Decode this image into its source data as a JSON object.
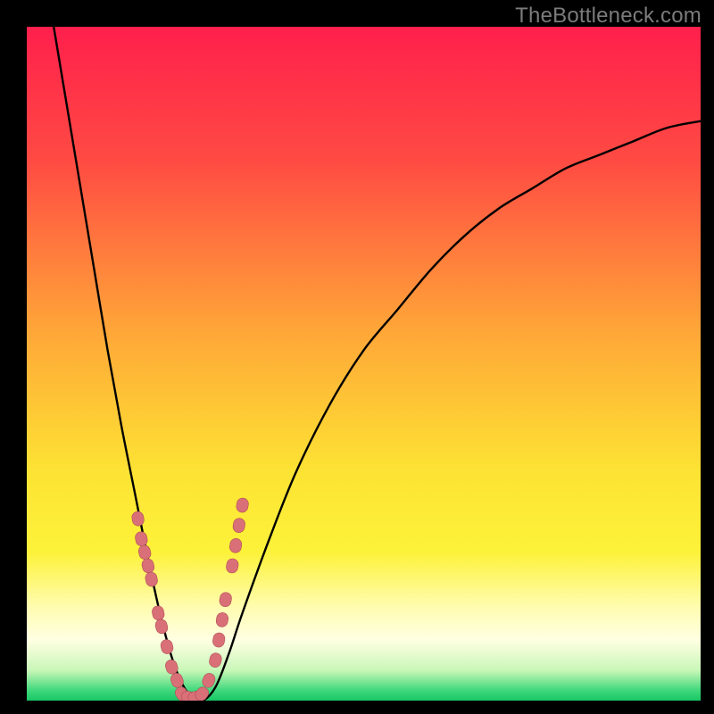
{
  "watermark": "TheBottleneck.com",
  "colors": {
    "frame": "#000000",
    "gradient_stops": [
      {
        "offset": 0.0,
        "color": "#ff1f4c"
      },
      {
        "offset": 0.2,
        "color": "#ff4b43"
      },
      {
        "offset": 0.45,
        "color": "#ffa638"
      },
      {
        "offset": 0.66,
        "color": "#fde333"
      },
      {
        "offset": 0.78,
        "color": "#fdf23a"
      },
      {
        "offset": 0.86,
        "color": "#fffcae"
      },
      {
        "offset": 0.91,
        "color": "#ffffe3"
      },
      {
        "offset": 0.955,
        "color": "#c9f7b8"
      },
      {
        "offset": 0.985,
        "color": "#3fd87b"
      },
      {
        "offset": 1.0,
        "color": "#17c765"
      }
    ],
    "curve": "#000000",
    "marker_fill": "#d97078",
    "marker_stroke": "#b24e56"
  },
  "chart_data": {
    "type": "line",
    "title": "",
    "xlabel": "",
    "ylabel": "",
    "xlim": [
      0,
      100
    ],
    "ylim": [
      0,
      100
    ],
    "series": [
      {
        "name": "bottleneck-curve",
        "comment": "V-shaped curve; y estimated as percentage from top (0=top, 100=bottom). Minimum (best/green zone) around x≈22–26.",
        "x": [
          4,
          6,
          8,
          10,
          12,
          14,
          16,
          18,
          20,
          22,
          24,
          26,
          28,
          30,
          32,
          36,
          40,
          45,
          50,
          55,
          60,
          65,
          70,
          75,
          80,
          85,
          90,
          95,
          100
        ],
        "y": [
          0,
          12,
          24,
          36,
          48,
          59,
          69,
          79,
          88,
          95,
          99,
          100,
          98,
          93,
          87,
          76,
          66,
          56,
          48,
          42,
          36,
          31,
          27,
          24,
          21,
          19,
          17,
          15,
          14
        ]
      }
    ],
    "markers": {
      "comment": "Pink capsule markers clustered near the valley of the V",
      "points": [
        {
          "x": 16.5,
          "y": 73
        },
        {
          "x": 17.0,
          "y": 76
        },
        {
          "x": 17.5,
          "y": 78
        },
        {
          "x": 18.0,
          "y": 80
        },
        {
          "x": 18.5,
          "y": 82
        },
        {
          "x": 19.5,
          "y": 87
        },
        {
          "x": 20.0,
          "y": 89
        },
        {
          "x": 20.8,
          "y": 92
        },
        {
          "x": 21.5,
          "y": 95
        },
        {
          "x": 22.3,
          "y": 97
        },
        {
          "x": 23.0,
          "y": 99
        },
        {
          "x": 24.0,
          "y": 99.5
        },
        {
          "x": 25.0,
          "y": 99.5
        },
        {
          "x": 26.0,
          "y": 99
        },
        {
          "x": 27.0,
          "y": 97
        },
        {
          "x": 28.0,
          "y": 94
        },
        {
          "x": 28.5,
          "y": 91
        },
        {
          "x": 29.0,
          "y": 88
        },
        {
          "x": 29.5,
          "y": 85
        },
        {
          "x": 30.5,
          "y": 80
        },
        {
          "x": 31.0,
          "y": 77
        },
        {
          "x": 31.5,
          "y": 74
        },
        {
          "x": 32.0,
          "y": 71
        }
      ]
    }
  }
}
